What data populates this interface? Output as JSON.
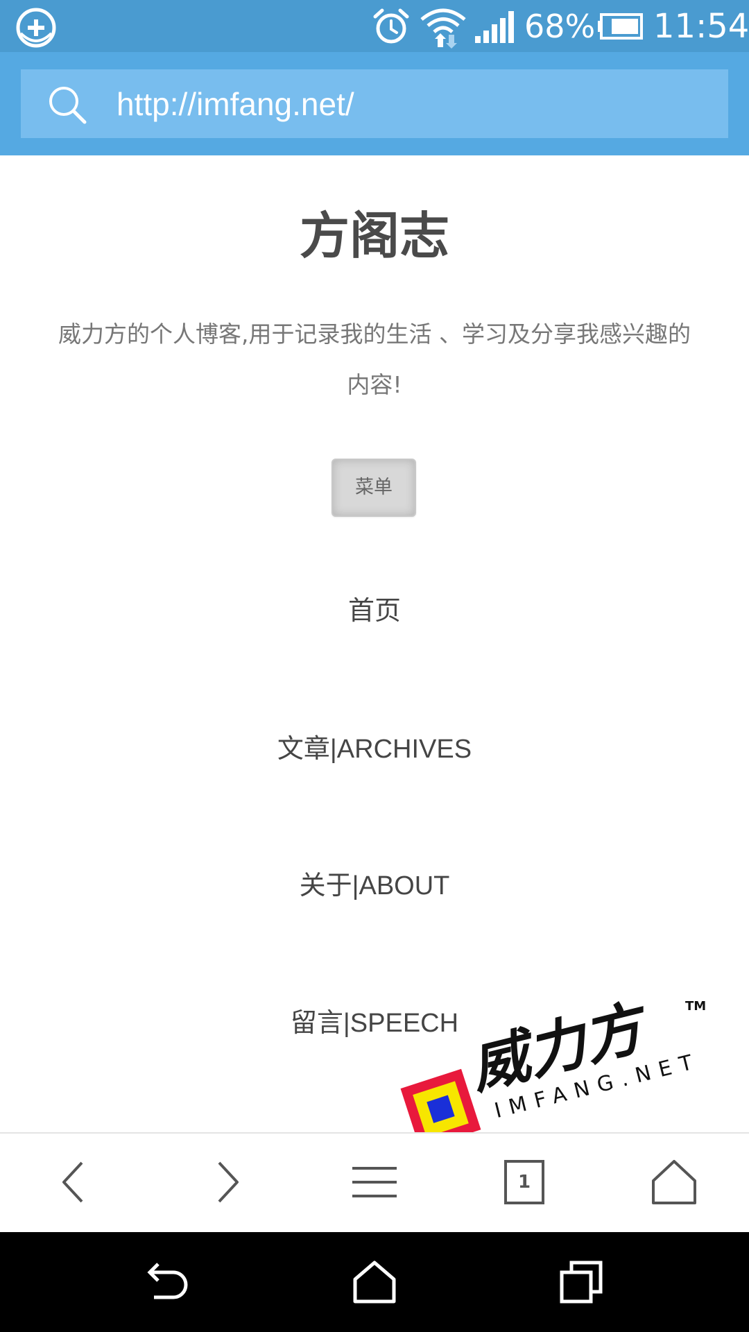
{
  "status_bar": {
    "battery_percent": "68%",
    "time": "11:54",
    "icons": [
      "app-notification-icon",
      "alarm-icon",
      "wifi-icon",
      "signal-icon",
      "battery-icon"
    ]
  },
  "address_bar": {
    "url": "http://imfang.net/",
    "icon": "search-icon"
  },
  "page": {
    "site_title": "方阁志",
    "description": "威力方的个人博客,用于记录我的生活 、学习及分享我感兴趣的内容!",
    "menu_button": "菜单",
    "nav_items": [
      {
        "label": "首页"
      },
      {
        "label": "文章|ARCHIVES"
      },
      {
        "label": "关于|ABOUT"
      },
      {
        "label": "留言|SPEECH"
      }
    ]
  },
  "watermark": {
    "brand": "威力方",
    "domain": "IMFANG.NET",
    "tm": "TM"
  },
  "browser_toolbar": {
    "tab_count": "1",
    "icons": [
      "back-icon",
      "forward-icon",
      "menu-icon",
      "tabs-icon",
      "home-icon"
    ]
  },
  "system_nav": {
    "icons": [
      "back-icon",
      "home-icon",
      "recent-apps-icon"
    ]
  },
  "colors": {
    "status_bar": "#4a9bd0",
    "header": "#55a9e2",
    "url_box": "#78bdee",
    "title_text": "#4a4a4a",
    "nav_text": "#454545"
  }
}
